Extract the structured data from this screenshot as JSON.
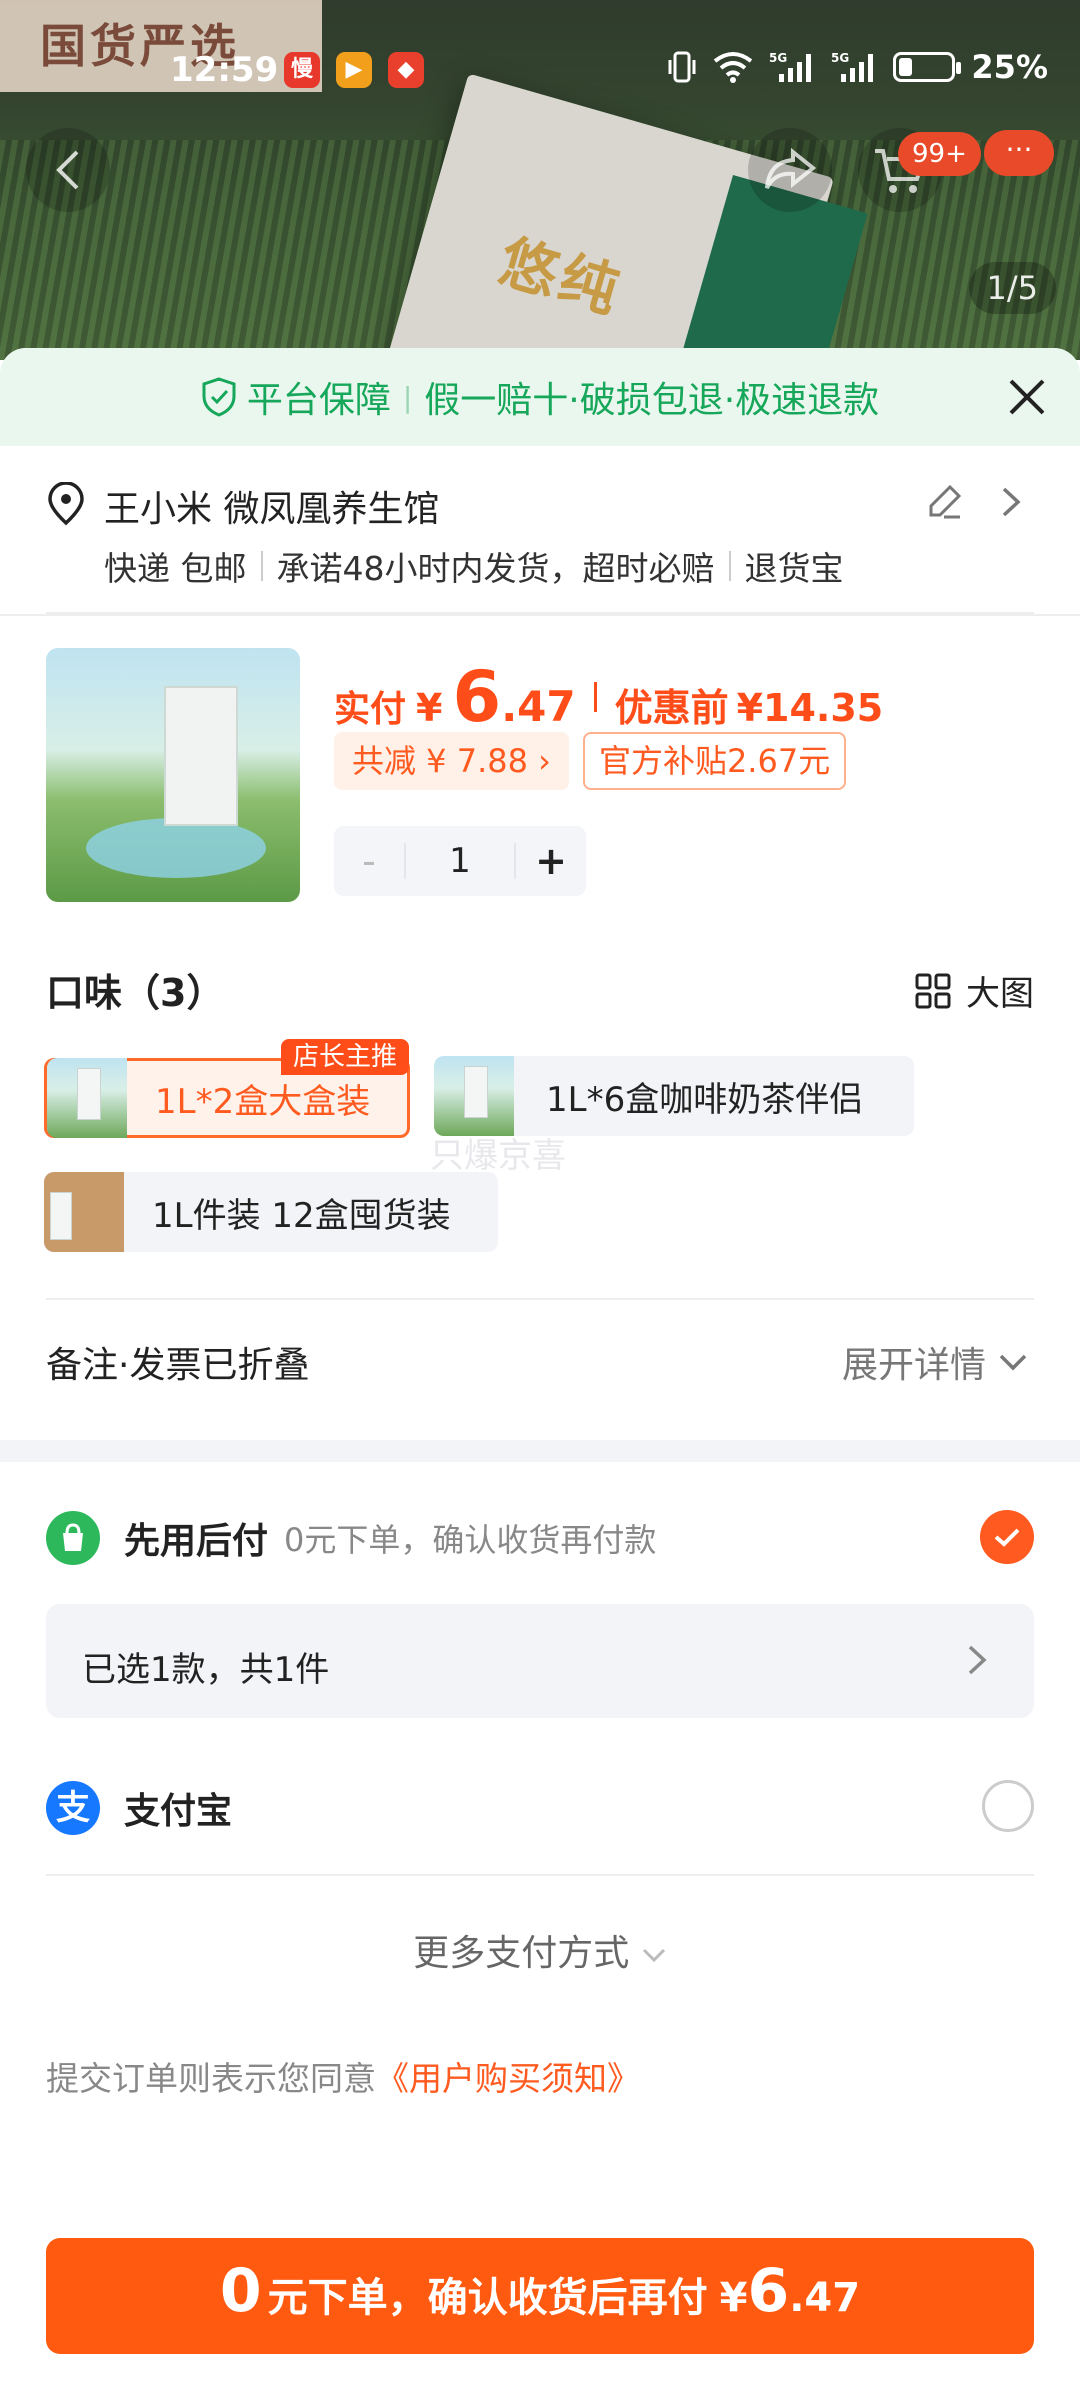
{
  "status_bar": {
    "time": "12:59",
    "battery": "25%",
    "battery_level": 0.25,
    "app_icons": [
      {
        "name": "manbo-app-icon",
        "glyph": "慢",
        "color": "#e8382c"
      },
      {
        "name": "video-app-icon",
        "glyph": "▶",
        "color": "#f2a01c"
      },
      {
        "name": "shop-app-icon",
        "glyph": "◆",
        "color": "#e8402c"
      }
    ]
  },
  "backdrop": {
    "watermark": "国货严选",
    "brand_text": "悠纯",
    "pager": "1/5",
    "cart_badge": "99+",
    "more_badge": "···"
  },
  "guarantee": {
    "title": "平台保障",
    "items": "假一赔十·破损包退·极速退款"
  },
  "address": {
    "name": "王小米 微凤凰养生馆",
    "delivery": [
      "快递 包邮",
      "承诺48小时内发货，超时必赔",
      "退货宝"
    ]
  },
  "product": {
    "paid_label": "实付",
    "currency": "¥",
    "price_int": "6",
    "price_dec": ".47",
    "before_label": "优惠前",
    "before_price": "¥14.35",
    "discount_tag": "共减 ¥ 7.88",
    "subsidy_tag": "官方补贴2.67元",
    "quantity": "1",
    "minus": "-",
    "plus": "+"
  },
  "flavor": {
    "title": "口味（3）",
    "big_image": "大图",
    "options": [
      {
        "label": "1L*2盒大盒装",
        "badge": "店长主推",
        "selected": true
      },
      {
        "label": "1L*6盒咖啡奶茶伴侣"
      },
      {
        "label": "1L件装 12盒囤货装"
      }
    ],
    "ghost_watermark": "只爆京喜"
  },
  "note": {
    "label": "备注·发票已折叠",
    "expand": "展开详情"
  },
  "payment": {
    "pay_later_title": "先用后付",
    "pay_later_sub": "0元下单，确认收货再付款",
    "selected_summary": "已选1款，共1件",
    "alipay": "支付宝",
    "more": "更多支付方式",
    "agree_prefix": "提交订单则表示您同意",
    "agree_link": "《用户购买须知》"
  },
  "cta": {
    "zero": "0",
    "text": "元下单，确认收货后再付",
    "currency": "¥",
    "amount_int": "6",
    "amount_dec": ".47"
  },
  "colors": {
    "accent": "#ff5a1f",
    "guarantee_green": "#16a75a",
    "alipay_blue": "#1677ff"
  }
}
